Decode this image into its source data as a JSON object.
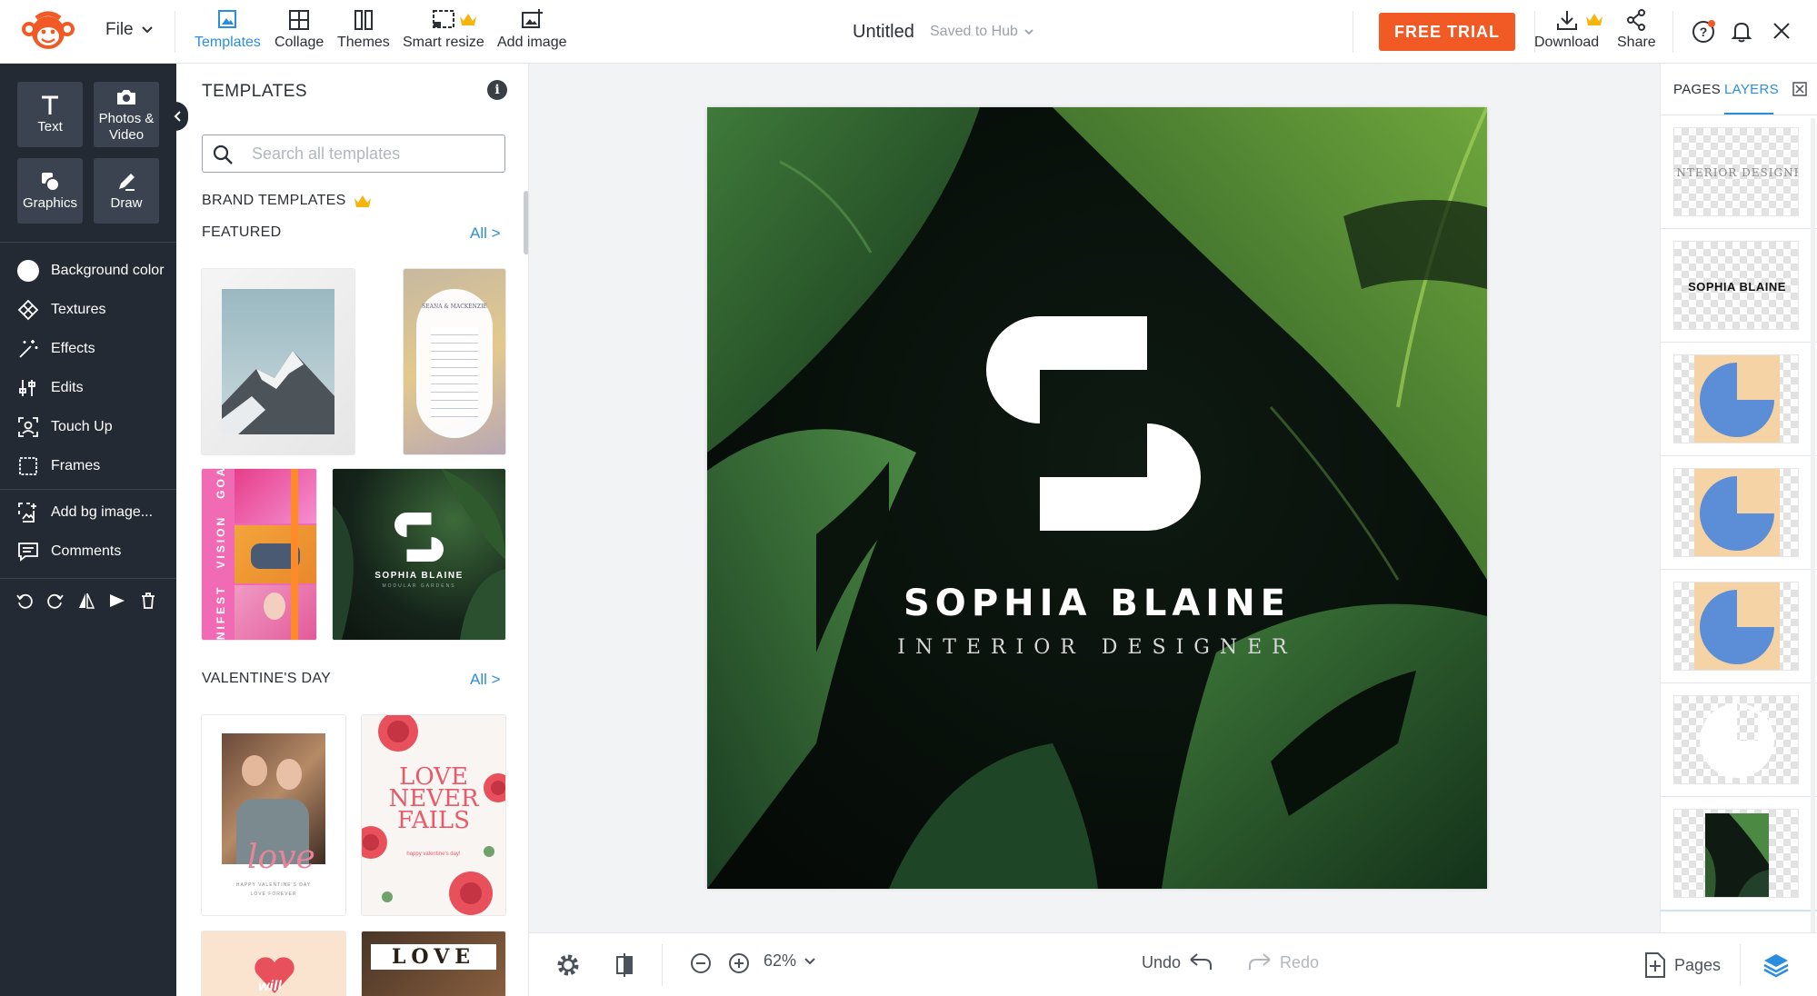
{
  "topbar": {
    "file_label": "File",
    "tools": [
      {
        "label": "Templates",
        "icon": "templates-icon",
        "active": true
      },
      {
        "label": "Collage",
        "icon": "collage-icon"
      },
      {
        "label": "Themes",
        "icon": "themes-icon"
      },
      {
        "label": "Smart resize",
        "icon": "smart-resize-icon",
        "premium": true
      },
      {
        "label": "Add image",
        "icon": "add-image-icon"
      }
    ],
    "doc_title": "Untitled",
    "saved_status": "Saved to Hub",
    "free_trial_label": "FREE TRIAL",
    "download_label": "Download",
    "share_label": "Share",
    "accent_color": "#2a8ede",
    "cta_color": "#f15a24"
  },
  "leftbar": {
    "big_buttons": [
      {
        "label": "Text",
        "icon": "text-icon"
      },
      {
        "label": "Photos & Video",
        "icon": "camera-icon"
      },
      {
        "label": "Graphics",
        "icon": "graphics-icon"
      },
      {
        "label": "Draw",
        "icon": "draw-icon"
      }
    ],
    "menu": [
      {
        "label": "Background color",
        "icon": "color-circle-icon"
      },
      {
        "label": "Textures",
        "icon": "textures-icon"
      },
      {
        "label": "Effects",
        "icon": "effects-icon"
      },
      {
        "label": "Edits",
        "icon": "edits-icon"
      },
      {
        "label": "Touch Up",
        "icon": "touch-up-icon"
      },
      {
        "label": "Frames",
        "icon": "frames-icon"
      },
      {
        "label": "Add bg image...",
        "icon": "add-bg-image-icon"
      },
      {
        "label": "Comments",
        "icon": "comments-icon"
      }
    ]
  },
  "templates_panel": {
    "title": "TEMPLATES",
    "search_placeholder": "Search all templates",
    "brand_templates_label": "BRAND TEMPLATES",
    "featured_label": "FEATURED",
    "valentines_label": "VALENTINE'S DAY",
    "all_link": "All >",
    "featured_cards": {
      "wedding_names": "SEANA & MACKENZIE",
      "collage_words": [
        "MANIFEST",
        "VISION",
        "GOALS"
      ],
      "logo_name": "SOPHIA BLAINE",
      "logo_sub": "MODULAR GARDENS"
    },
    "valentine_cards": {
      "love_script": "love",
      "love_caption": "HAPPY VALENTINE'S DAY",
      "love_caption2": "LOVE FOREVER",
      "love_never_fails_lines": [
        "LOVE",
        "NEVER",
        "FAILS"
      ],
      "love_never_fails_caption": "happy valentine's day!",
      "will_text": "will",
      "love_banner": "LOVE"
    }
  },
  "canvas": {
    "brand_name": "SOPHIA BLAINE",
    "brand_sub": "INTERIOR DESIGNER"
  },
  "bottombar": {
    "zoom": "62%",
    "undo_label": "Undo",
    "redo_label": "Redo",
    "pages_label": "Pages"
  },
  "layers_panel": {
    "tabs": [
      "PAGES",
      "LAYERS"
    ],
    "active_tab": "LAYERS",
    "layer_texts": [
      "INTERIOR DESIGNE",
      "SOPHIA BLAINE"
    ]
  }
}
